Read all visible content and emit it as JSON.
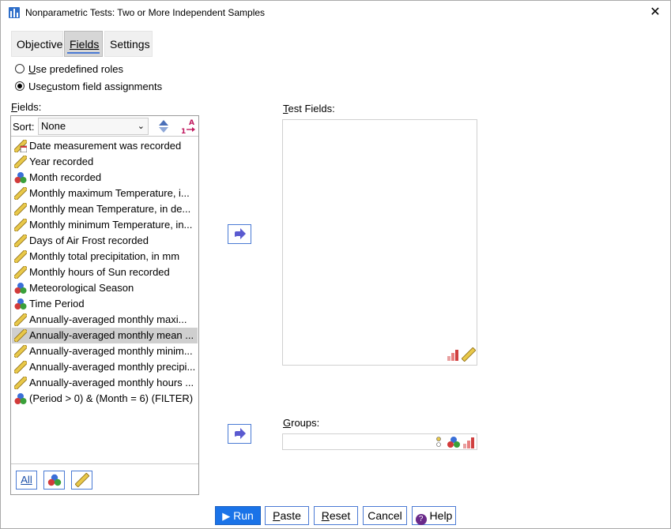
{
  "window": {
    "title": "Nonparametric Tests: Two or More Independent Samples",
    "close_glyph": "✕"
  },
  "tabs": [
    {
      "label": "Objective",
      "active": false
    },
    {
      "label": "Fields",
      "active": true
    },
    {
      "label": "Settings",
      "active": false
    }
  ],
  "radios": {
    "predefined": {
      "prefix": "",
      "underline": "U",
      "rest": "se predefined roles",
      "checked": false
    },
    "custom": {
      "prefix": "Use ",
      "underline": "c",
      "rest": "ustom field assignments",
      "checked": true
    }
  },
  "fields_panel": {
    "label_underline": "F",
    "label_rest": "ields:",
    "sort_label": "Sort:",
    "sort_value": "None",
    "items": [
      {
        "label": "Date measurement was recorded",
        "icon": "date-ruler-icon",
        "selected": false
      },
      {
        "label": "Year recorded",
        "icon": "scale-ruler-icon",
        "selected": false
      },
      {
        "label": "Month recorded",
        "icon": "nominal-icon",
        "selected": false
      },
      {
        "label": "Monthly maximum Temperature, i...",
        "icon": "scale-ruler-icon",
        "selected": false
      },
      {
        "label": "Monthly mean Temperature, in de...",
        "icon": "scale-ruler-icon",
        "selected": false
      },
      {
        "label": "Monthly minimum Temperature, in...",
        "icon": "scale-ruler-icon",
        "selected": false
      },
      {
        "label": "Days of Air Frost recorded",
        "icon": "scale-ruler-icon",
        "selected": false
      },
      {
        "label": "Monthly total precipitation, in mm",
        "icon": "scale-ruler-icon",
        "selected": false
      },
      {
        "label": "Monthly hours of Sun recorded",
        "icon": "scale-ruler-icon",
        "selected": false
      },
      {
        "label": "Meteorological Season",
        "icon": "nominal-icon",
        "selected": false
      },
      {
        "label": "Time Period",
        "icon": "nominal-icon",
        "selected": false
      },
      {
        "label": "Annually-averaged monthly maxi...",
        "icon": "scale-ruler-icon",
        "selected": false
      },
      {
        "label": "Annually-averaged monthly mean ...",
        "icon": "scale-ruler-icon",
        "selected": true
      },
      {
        "label": "Annually-averaged monthly minim...",
        "icon": "scale-ruler-icon",
        "selected": false
      },
      {
        "label": "Annually-averaged monthly precipi...",
        "icon": "scale-ruler-icon",
        "selected": false
      },
      {
        "label": "Annually-averaged monthly hours ...",
        "icon": "scale-ruler-icon",
        "selected": false
      },
      {
        "label": "(Period > 0) & (Month = 6) (FILTER)",
        "icon": "nominal-icon",
        "selected": false
      }
    ],
    "footer_all": "All"
  },
  "test_fields": {
    "label_underline": "T",
    "label_rest": "est Fields:"
  },
  "groups": {
    "label_underline": "G",
    "label_rest": "roups:"
  },
  "buttons": {
    "run": "Run",
    "paste_u": "P",
    "paste_rest": "aste",
    "reset_u": "R",
    "reset_rest": "eset",
    "cancel": "Cancel",
    "help": "Help"
  },
  "colors": {
    "accent": "#1a73e8",
    "selected_row": "#cfcfcf",
    "move_arrow": "#5a5ad0"
  }
}
